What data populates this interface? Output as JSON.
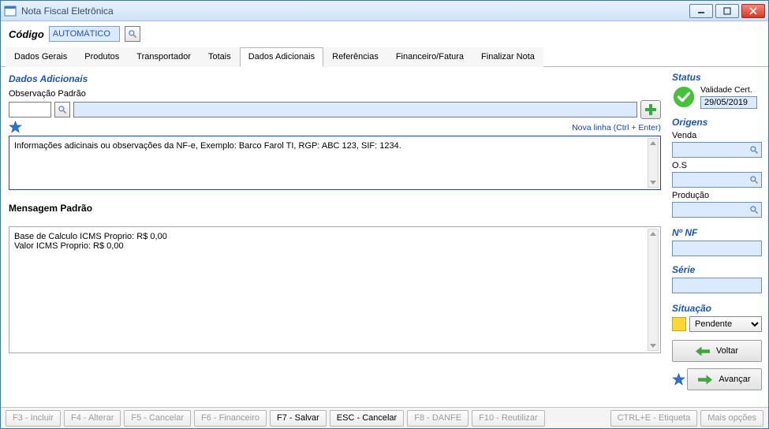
{
  "window": {
    "title": "Nota Fiscal Eletrônica"
  },
  "codigo": {
    "label": "Código",
    "value": "AUTOMÁTICO"
  },
  "tabs": {
    "items": [
      {
        "label": "Dados Gerais"
      },
      {
        "label": "Produtos"
      },
      {
        "label": "Transportador"
      },
      {
        "label": "Totais"
      },
      {
        "label": "Dados Adicionais"
      },
      {
        "label": "Referências"
      },
      {
        "label": "Financeiro/Fatura"
      },
      {
        "label": "Finalizar Nota"
      }
    ],
    "active_index": 4
  },
  "dados_adicionais": {
    "title": "Dados Adicionais",
    "observacao_padrao_label": "Observação Padrão",
    "nova_linha_hint": "Nova linha (Ctrl + Enter)",
    "obs_text": "Informações adicinais ou observações da NF-e, Exemplo: Barco Farol TI, RGP: ABC 123, SIF: 1234.",
    "mensagem_padrao_label": "Mensagem Padrão",
    "mensagem_text": "Base de Calculo ICMS Proprio: R$ 0,00\nValor ICMS Proprio: R$ 0,00"
  },
  "sidebar": {
    "status_label": "Status",
    "validade_label": "Validade Cert.",
    "validade_date": "29/05/2019",
    "origens_label": "Origens",
    "venda_label": "Venda",
    "os_label": "O.S",
    "producao_label": "Produção",
    "nf_label": "Nº NF",
    "serie_label": "Série",
    "situacao_label": "Situação",
    "situacao_value": "Pendente",
    "situacao_color": "#ffd633",
    "voltar_label": "Voltar",
    "avancar_label": "Avançar"
  },
  "bottom": {
    "incluir": "F3 - Incluir",
    "alterar": "F4 - Alterar",
    "cancelar": "F5 - Cancelar",
    "financeiro": "F6 - Financeiro",
    "salvar": "F7 - Salvar",
    "esc_cancelar": "ESC - Cancelar",
    "danfe": "F8 - DANFE",
    "reutilizar": "F10 - Reutilizar",
    "etiqueta": "CTRL+E - Etiqueta",
    "mais": "Mais opções"
  }
}
